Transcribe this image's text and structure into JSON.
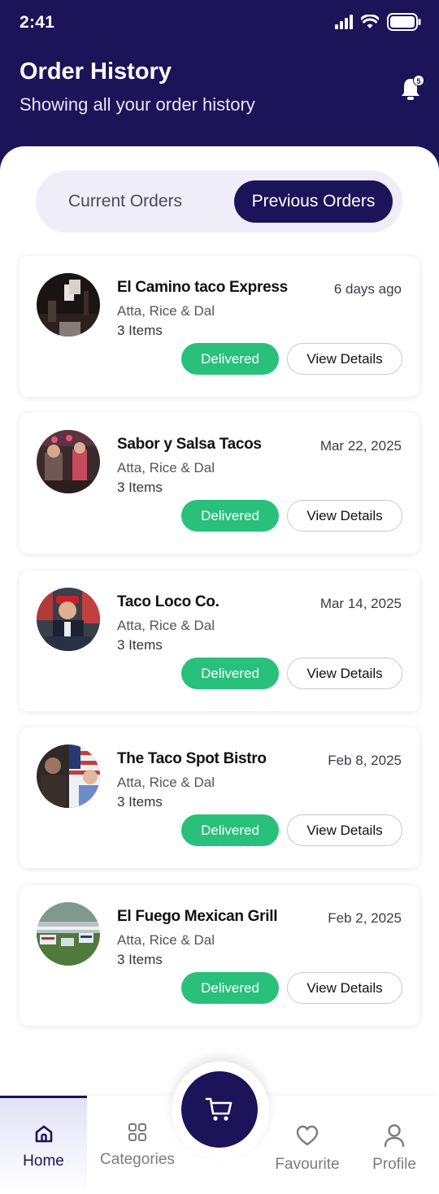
{
  "status_bar": {
    "time": "2:41"
  },
  "header": {
    "title": "Order History",
    "subtitle": "Showing all your order history",
    "notification_count": "5"
  },
  "tabs": {
    "current": "Current Orders",
    "previous": "Previous Orders",
    "active": "previous"
  },
  "orders": [
    {
      "name": "El Camino taco Express",
      "date": "6 days ago",
      "desc": "Atta, Rice & Dal",
      "items": "3 Items",
      "status": "Delivered",
      "action": "View Details"
    },
    {
      "name": "Sabor y Salsa Tacos",
      "date": "Mar 22, 2025",
      "desc": "Atta, Rice & Dal",
      "items": "3 Items",
      "status": "Delivered",
      "action": "View Details"
    },
    {
      "name": "Taco Loco Co.",
      "date": "Mar 14, 2025",
      "desc": "Atta, Rice & Dal",
      "items": "3 Items",
      "status": "Delivered",
      "action": "View Details"
    },
    {
      "name": "The Taco Spot Bistro",
      "date": "Feb 8, 2025",
      "desc": "Atta, Rice & Dal",
      "items": "3 Items",
      "status": "Delivered",
      "action": "View Details"
    },
    {
      "name": "El Fuego Mexican Grill",
      "date": "Feb 2, 2025",
      "desc": "Atta, Rice & Dal",
      "items": "3 Items",
      "status": "Delivered",
      "action": "View Details"
    }
  ],
  "nav": {
    "home": "Home",
    "categories": "Categories",
    "favourite": "Favourite",
    "profile": "Profile",
    "active": "home"
  },
  "colors": {
    "brand": "#1b1459",
    "delivered": "#28c07a",
    "tab_bg": "#eeedf8"
  },
  "icons": {
    "signal": "signal-icon",
    "wifi": "wifi-icon",
    "battery": "battery-icon",
    "bell": "bell-icon",
    "cart": "cart-icon",
    "home": "home-icon",
    "categories": "grid-icon",
    "favourite": "heart-icon",
    "profile": "user-icon"
  }
}
